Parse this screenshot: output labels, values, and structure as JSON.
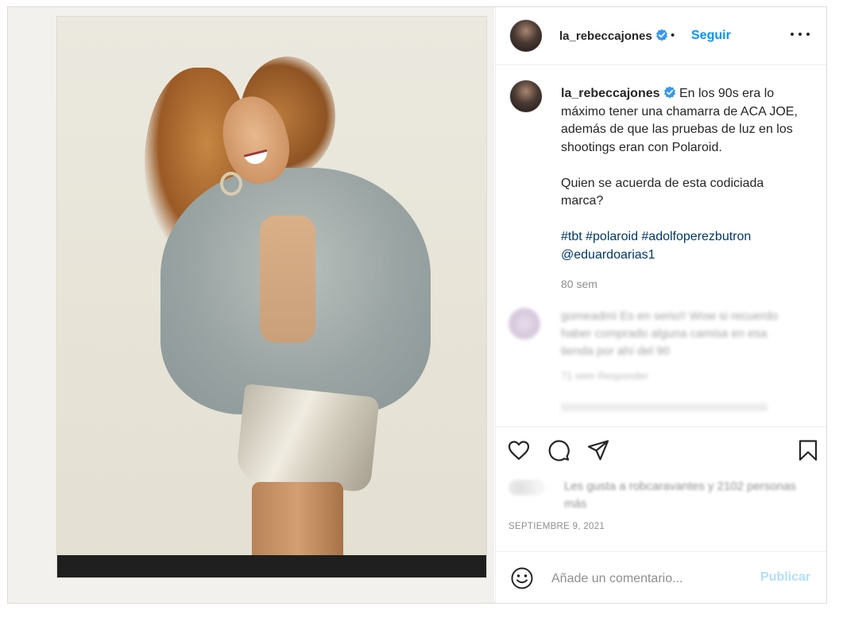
{
  "post": {
    "username": "la_rebeccajones",
    "follow_label": "Seguir",
    "separator": "•",
    "caption_lines": [
      "En los 90s era lo máximo tener una chamarra de ACA JOE, además de que las pruebas de luz en los shootings eran con Polaroid.",
      "Quien se acuerda de esta codiciada marca?"
    ],
    "hashtags": "#tbt #polaroid #adolfoperezbutron",
    "mention": "@eduardoarias1",
    "caption_time": "80 sem",
    "blurred_comment": {
      "text": "gomeadmi Es en serio!! Wow si recuerdo haber comprado alguna camisa en esa tienda por ahí del 90",
      "meta": "71 sem   Responder"
    },
    "likes_text": "Les gusta a robcaravantes y 2102 personas más",
    "date": "SEPTIEMBRE 9, 2021",
    "comment_placeholder": "Añade un comentario...",
    "publish_label": "Publicar"
  },
  "colors": {
    "link_blue": "#0095f6",
    "tag_blue": "#00376b",
    "muted": "#8e8e8e",
    "publish_disabled": "#b2dffc"
  }
}
